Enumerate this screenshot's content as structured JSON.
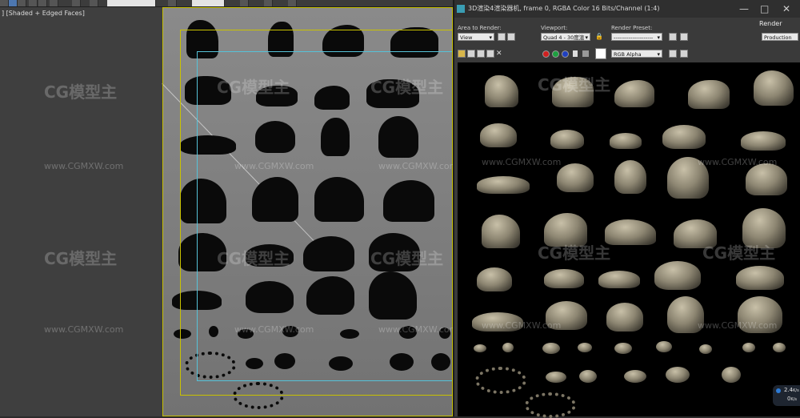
{
  "toolbar": {
    "buttons": 14
  },
  "left_viewport": {
    "label": "] [Shaded + Edged Faces]"
  },
  "render_window": {
    "title": "3D渲染4渲染器机, frame 0, RGBA Color 16 Bits/Channel (1:4)",
    "area_to_render_label": "Area to Render:",
    "area_to_render_value": "View",
    "viewport_label": "Viewport:",
    "viewport_value": "Quad 4 - 30度渲",
    "render_preset_label": "Render Preset:",
    "render_preset_value": "---------------------",
    "render_label": "Render",
    "render_mode_value": "Production",
    "channel_value": "RGB Alpha",
    "window_controls": [
      "—",
      "□",
      "✕"
    ]
  },
  "watermark": {
    "logo_text": "CG模型主",
    "url_text": "www.CGMXW.com"
  },
  "stats": {
    "up": "2.4",
    "up_unit": "K/s",
    "down": "0",
    "down_unit": "K/s"
  },
  "colors": {
    "accent": "#4d77b0",
    "safe_frame_yellow": "#c9c200",
    "safe_frame_cyan": "#56c2d8"
  }
}
